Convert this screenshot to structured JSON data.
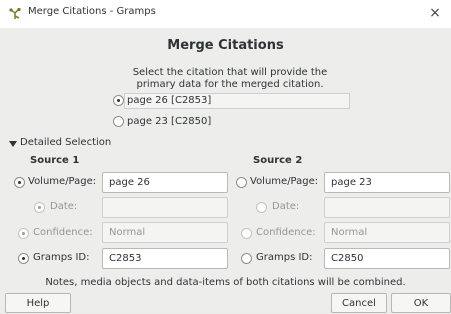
{
  "window": {
    "title": "Merge Citations - Gramps",
    "close_glyph": "×"
  },
  "header": {
    "title": "Merge Citations",
    "description_line1": "Select the citation that will provide the",
    "description_line2": "primary data for the merged citation."
  },
  "primary_choice": {
    "options": [
      {
        "label": "page 26 [C2853]",
        "selected": true
      },
      {
        "label": "page 23 [C2850]",
        "selected": false
      }
    ]
  },
  "detailed": {
    "expander_label": "Detailed Selection",
    "expanded": true,
    "source1_title": "Source 1",
    "source2_title": "Source 2",
    "rows": [
      {
        "label": "Volume/Page:",
        "value1": "page 26",
        "value2": "page 23",
        "selected": 1,
        "enabled": true
      },
      {
        "label": "Date:",
        "value1": "",
        "value2": "",
        "selected": 1,
        "enabled": false
      },
      {
        "label": "Confidence:",
        "value1": "Normal",
        "value2": "Normal",
        "selected": 1,
        "enabled": false
      },
      {
        "label": "Gramps ID:",
        "value1": "C2853",
        "value2": "C2850",
        "selected": 1,
        "enabled": true
      }
    ]
  },
  "footer": {
    "note": "Notes, media objects and data-items of both citations will be combined.",
    "help_label": "Help",
    "cancel_label": "Cancel",
    "ok_label": "OK"
  },
  "icons": {
    "app_icon": "gramps-tree-icon",
    "expander_icon": "triangle-down-icon"
  }
}
